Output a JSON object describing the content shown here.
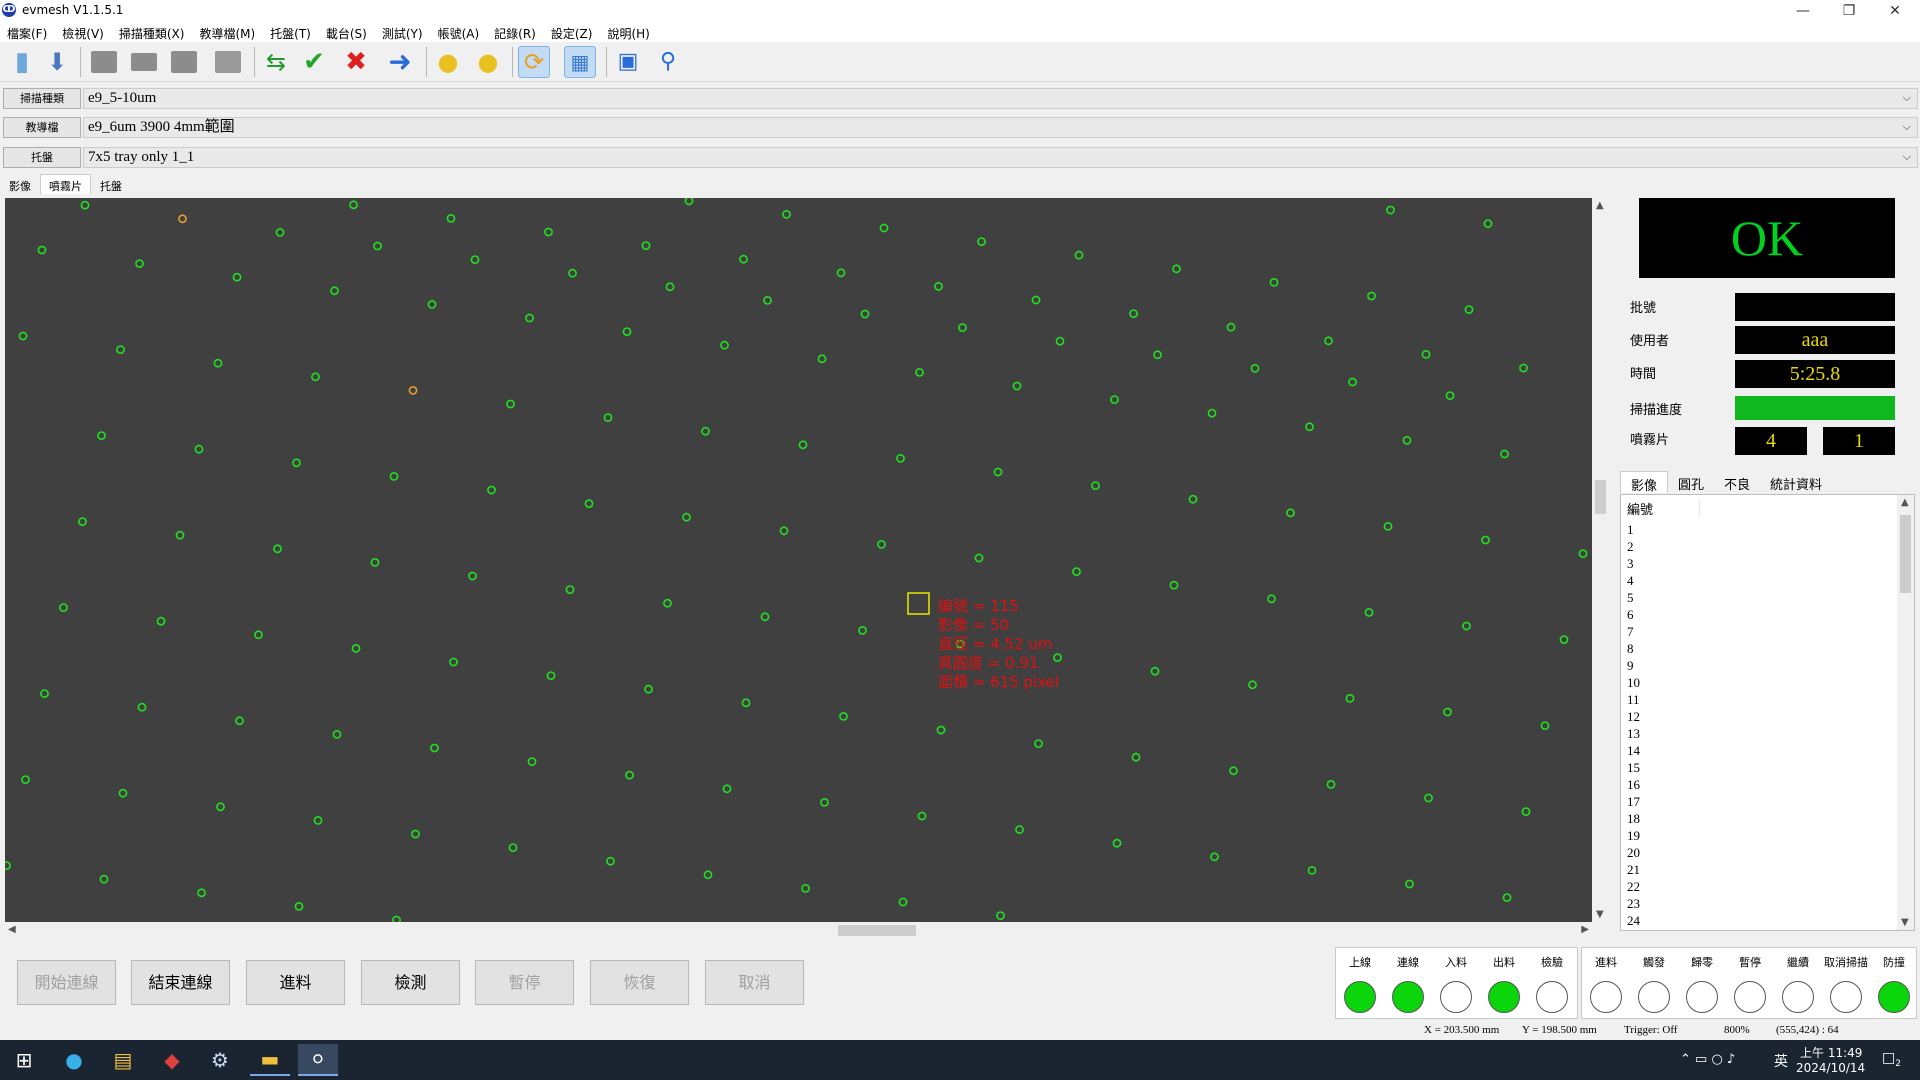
{
  "window": {
    "title": "evmesh V1.1.5.1",
    "logo_glyph": "ↀ"
  },
  "menu": [
    "檔案(F)",
    "檢視(V)",
    "掃描種類(X)",
    "教導檔(M)",
    "托盤(T)",
    "載台(S)",
    "測試(Y)",
    "帳號(A)",
    "記錄(R)",
    "設定(Z)",
    "說明(H)"
  ],
  "selectors": {
    "scan_type": {
      "label": "掃描種類",
      "value": "e9_5-10um"
    },
    "teach_file": {
      "label": "教導檔",
      "value": "e9_6um 3900 4mm範圍"
    },
    "tray": {
      "label": "托盤",
      "value": "7x5 tray only 1_1"
    }
  },
  "tabs_top": [
    "影像",
    "噴霧片",
    "托盤"
  ],
  "info": {
    "number": "編號 = 115",
    "image": "影像 = 50",
    "diameter": "直徑 = 4.52 um",
    "roundness": "真圓度 = 0.91",
    "area": "面積 = 615 pixel"
  },
  "status_panel": {
    "result": "OK",
    "batch_label": "批號",
    "batch_value": "",
    "user_label": "使用者",
    "user_value": "aaa",
    "time_label": "時間",
    "time_value": "5:25.8",
    "progress_label": "掃描進度",
    "progress_value": 1.0,
    "spray_label": "噴霧片",
    "spray_value_1": "4",
    "spray_value_2": "1"
  },
  "tabs_right": [
    "影像",
    "圓孔",
    "不良",
    "統計資料"
  ],
  "list": {
    "header": "編號",
    "items": [
      "1",
      "2",
      "3",
      "4",
      "5",
      "6",
      "7",
      "8",
      "9",
      "10",
      "11",
      "12",
      "13",
      "14",
      "15",
      "16",
      "17",
      "18",
      "19",
      "20",
      "21",
      "22",
      "23",
      "24"
    ]
  },
  "commands": {
    "start_online": "開始連線",
    "end_online": "結束連線",
    "feed": "進料",
    "inspect": "檢測",
    "pause": "暫停",
    "resume": "恢復",
    "cancel": "取消"
  },
  "lamps_left": [
    {
      "label": "上線",
      "on": true
    },
    {
      "label": "連線",
      "on": true
    },
    {
      "label": "入料",
      "on": false
    },
    {
      "label": "出料",
      "on": true
    },
    {
      "label": "檢驗",
      "on": false
    }
  ],
  "lamps_right": [
    {
      "label": "進料",
      "on": false
    },
    {
      "label": "觸發",
      "on": false
    },
    {
      "label": "歸零",
      "on": false
    },
    {
      "label": "暫停",
      "on": false
    },
    {
      "label": "繼續",
      "on": false
    },
    {
      "label": "取消掃描",
      "on": false
    },
    {
      "label": "防撞",
      "on": true
    }
  ],
  "statusbar": {
    "x": "X = 203.500 mm",
    "y": "Y = 198.500 mm",
    "trigger": "Trigger: Off",
    "zoom": "800%",
    "pixel": "(555,424) : 64"
  },
  "taskbar": {
    "ime": "英",
    "time": "上午 11:49",
    "date": "2024/10/14",
    "notif_count": "2"
  },
  "colors": {
    "canvas_bg": "#404040",
    "hole_ok": "#20e020",
    "hole_warn": "#e8a030",
    "info_text": "#e01010",
    "ok_text": "#00d020",
    "lamp_on": "#0ad40a"
  }
}
